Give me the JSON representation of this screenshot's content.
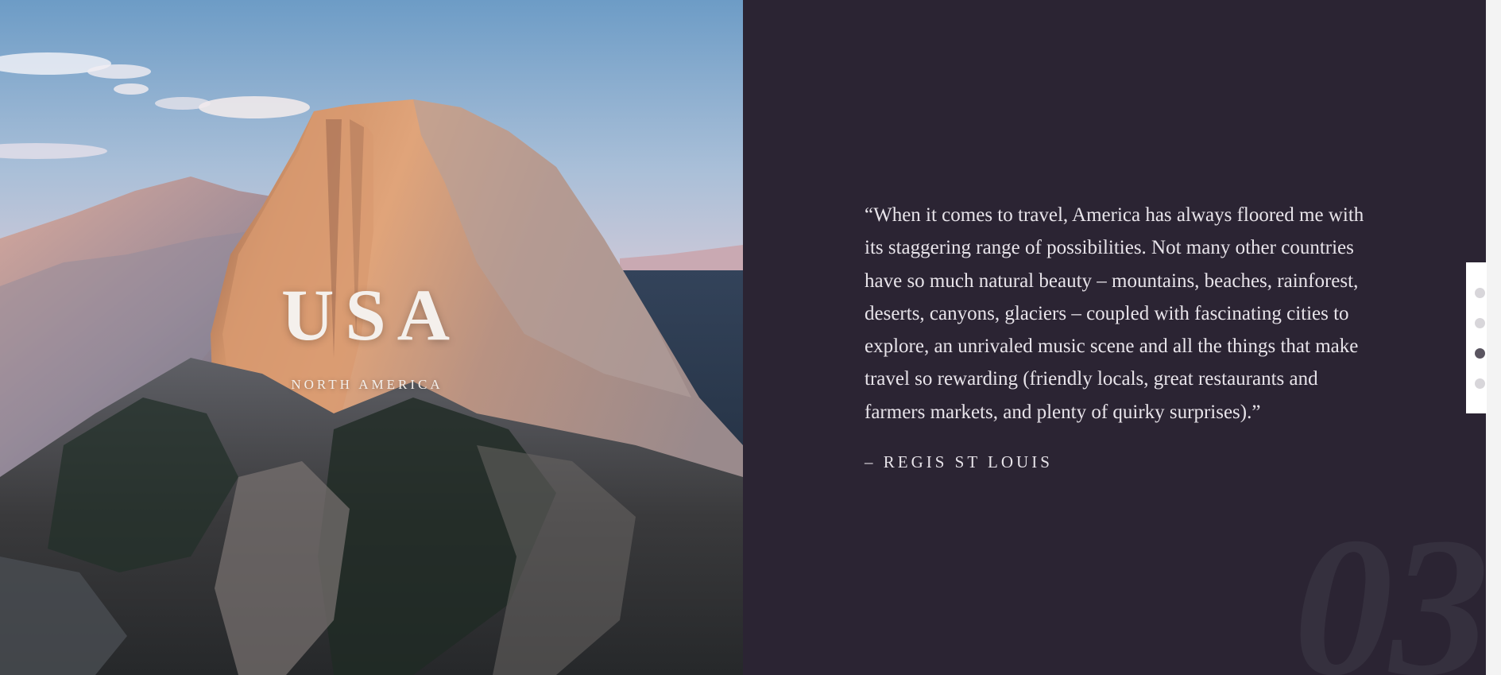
{
  "hero": {
    "title": "USA",
    "subtitle": "NORTH AMERICA"
  },
  "quote": {
    "text": "“When it comes to travel, America has always floored me with its staggering range of possibilities. Not many other countries have so much natural beauty – mountains, beaches, rainforest, deserts, canyons, glaciers – coupled with fascinating cities to explore, an unrivaled music scene and all the things that make travel so rewarding (friendly locals, great restaurants and farmers markets, and plenty of quirky surprises).”",
    "author": "– REGIS ST LOUIS"
  },
  "slide": {
    "number": "03"
  },
  "nav": {
    "dots": [
      {
        "active": false
      },
      {
        "active": false
      },
      {
        "active": true
      },
      {
        "active": false
      }
    ]
  },
  "colors": {
    "panel_background": "#2b2433",
    "quote_text": "#e8e4ea",
    "slide_number": "#35303e",
    "dot_inactive": "#d8d6da",
    "dot_active": "#5a5560"
  },
  "image": {
    "subject": "granite-dome-mountain-landscape-icon"
  }
}
